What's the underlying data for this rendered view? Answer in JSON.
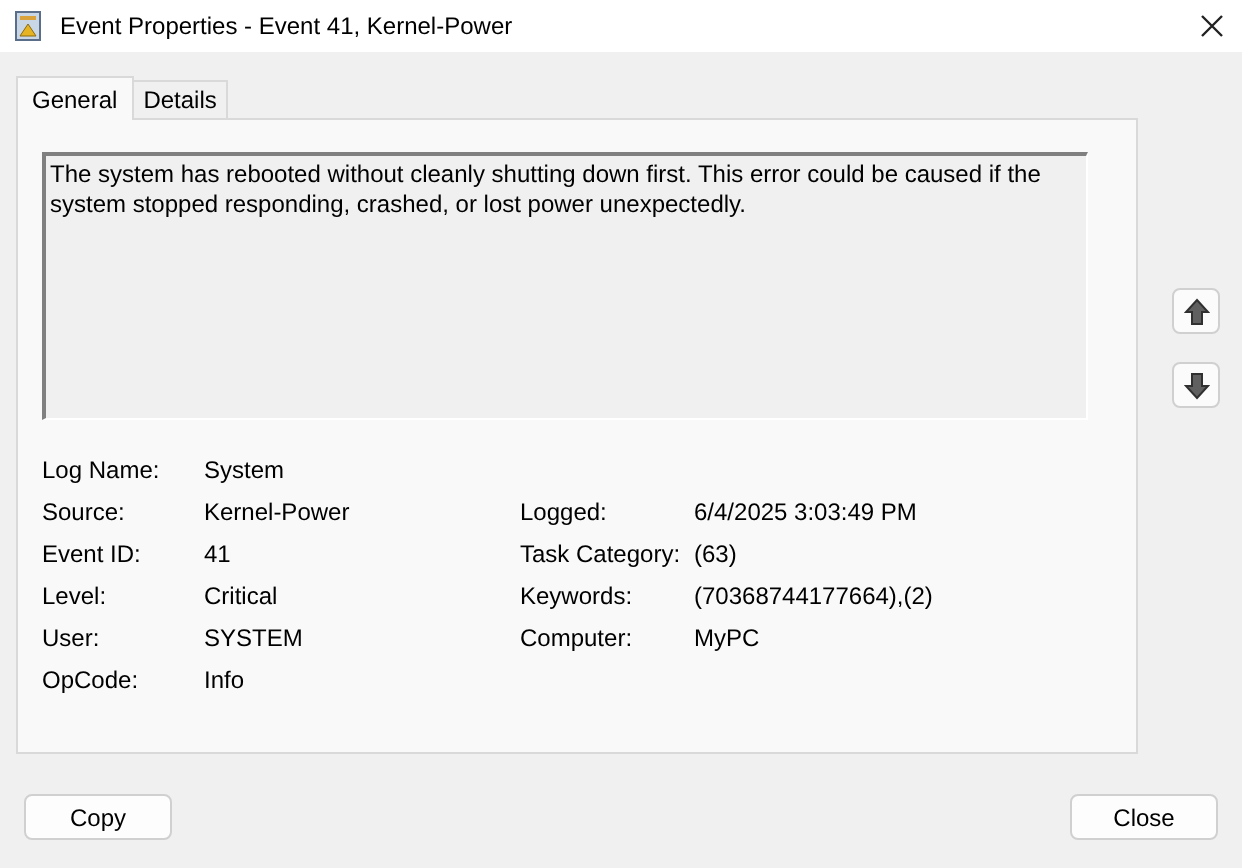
{
  "window": {
    "title": "Event Properties - Event 41, Kernel-Power"
  },
  "tabs": [
    {
      "label": "General",
      "selected": true
    },
    {
      "label": "Details",
      "selected": false
    }
  ],
  "description": "The system has rebooted without cleanly shutting down first. This error could be caused if the system stopped responding, crashed, or lost power unexpectedly.",
  "fields": [
    {
      "label": "Log Name:",
      "value": "System"
    },
    {
      "label": "Source:",
      "value": "Kernel-Power",
      "right_label": "Logged:",
      "right_value": "6/4/2025 3:03:49 PM"
    },
    {
      "label": "Event ID:",
      "value": "41",
      "right_label": "Task Category:",
      "right_value": "(63)"
    },
    {
      "label": "Level:",
      "value": "Critical",
      "right_label": "Keywords:",
      "right_value": "(70368744177664),(2)"
    },
    {
      "label": "User:",
      "value": "SYSTEM",
      "right_label": "Computer:",
      "right_value": "MyPC"
    },
    {
      "label": "OpCode:",
      "value": "Info"
    }
  ],
  "buttons": [
    "Copy",
    "Close"
  ]
}
